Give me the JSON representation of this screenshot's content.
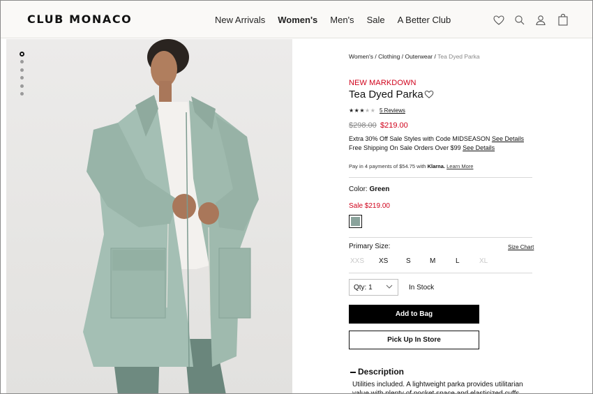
{
  "header": {
    "logo": "CLUB MONACO",
    "nav": [
      "New Arrivals",
      "Women's",
      "Men's",
      "Sale",
      "A Better Club"
    ],
    "active_nav": "Women's",
    "icons": [
      "heart-icon",
      "search-icon",
      "user-icon",
      "bag-icon"
    ]
  },
  "gallery": {
    "dots": 6,
    "active_dot": 0,
    "image_subject": "model wearing a sage green parka over white top"
  },
  "breadcrumb": {
    "items": [
      "Women's",
      "Clothing",
      "Outerwear"
    ],
    "current": "Tea Dyed Parka",
    "separator": "/"
  },
  "product": {
    "badge": "NEW MARKDOWN",
    "name": "Tea Dyed Parka",
    "rating": 3,
    "rating_max": 5,
    "reviews_label": "5 Reviews",
    "was_price": "$298.00",
    "price": "$219.00",
    "promo_1_text": "Extra 30% Off Sale Styles with Code MIDSEASON",
    "promo_1_link": "See Details",
    "promo_2_text": "Free Shipping On Sale Orders Over $99",
    "promo_2_link": "See Details",
    "klarna_text": "Pay in 4 payments of $54.75 with",
    "klarna_brand": "Klarna.",
    "klarna_link": "Learn More"
  },
  "color": {
    "label": "Color:",
    "value": "Green",
    "sale_label": "Sale $219.00",
    "swatch_color": "#8aa39c"
  },
  "size": {
    "label": "Primary Size:",
    "chart_link": "Size Chart",
    "options": [
      {
        "label": "XXS",
        "available": false
      },
      {
        "label": "XS",
        "available": true
      },
      {
        "label": "S",
        "available": true
      },
      {
        "label": "M",
        "available": true
      },
      {
        "label": "L",
        "available": true
      },
      {
        "label": "XL",
        "available": false
      }
    ]
  },
  "purchase": {
    "qty_label": "Qty: 1",
    "stock_status": "In Stock",
    "add_to_bag": "Add to Bag",
    "pick_up": "Pick Up In Store"
  },
  "description": {
    "heading": "Description",
    "text": "Utilities included. A lightweight parka provides utilitarian value with plenty of pocket space and elasticized cuffs. An"
  },
  "colors": {
    "sale_red": "#d0021b",
    "button_black": "#000000",
    "header_bg": "#faf9f7"
  }
}
